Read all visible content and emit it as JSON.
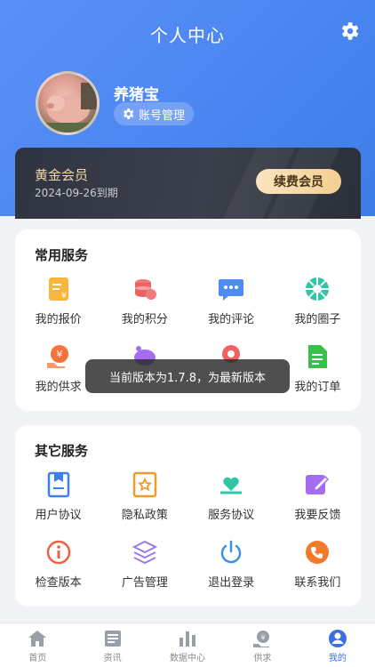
{
  "header": {
    "title": "个人中心",
    "settings_icon": "gear-icon"
  },
  "profile": {
    "name": "养猪宝",
    "account_button": "账号管理"
  },
  "vip": {
    "level": "黄金会员",
    "expiry": "2024-09-26到期",
    "renew_label": "续费会员"
  },
  "common_services": {
    "title": "常用服务",
    "items": [
      {
        "label": "我的报价",
        "icon": "quote-icon"
      },
      {
        "label": "我的积分",
        "icon": "coins-icon"
      },
      {
        "label": "我的评论",
        "icon": "comment-icon"
      },
      {
        "label": "我的圈子",
        "icon": "circle-icon"
      },
      {
        "label": "我的供求",
        "icon": "supply-icon"
      },
      {
        "label": "",
        "icon": "pig-icon"
      },
      {
        "label": "",
        "icon": "location-icon"
      },
      {
        "label": "我的订单",
        "icon": "order-icon"
      }
    ]
  },
  "other_services": {
    "title": "其它服务",
    "items": [
      {
        "label": "用户协议",
        "icon": "agreement-icon"
      },
      {
        "label": "隐私政策",
        "icon": "privacy-icon"
      },
      {
        "label": "服务协议",
        "icon": "service-icon"
      },
      {
        "label": "我要反馈",
        "icon": "feedback-icon"
      },
      {
        "label": "检查版本",
        "icon": "info-icon"
      },
      {
        "label": "广告管理",
        "icon": "layers-icon"
      },
      {
        "label": "退出登录",
        "icon": "power-icon"
      },
      {
        "label": "联系我们",
        "icon": "phone-icon"
      }
    ]
  },
  "toast": {
    "message": "当前版本为1.7.8，为最新版本"
  },
  "tabbar": {
    "items": [
      {
        "label": "首页",
        "icon": "home-icon"
      },
      {
        "label": "资讯",
        "icon": "news-icon"
      },
      {
        "label": "数据中心",
        "icon": "data-icon"
      },
      {
        "label": "供求",
        "icon": "supply-tab-icon"
      },
      {
        "label": "我的",
        "icon": "profile-icon",
        "active": true
      }
    ]
  },
  "colors": {
    "header_blue": "#4b86f0",
    "active_tab": "#3b6fe0",
    "gold": "#f1d6a4"
  }
}
